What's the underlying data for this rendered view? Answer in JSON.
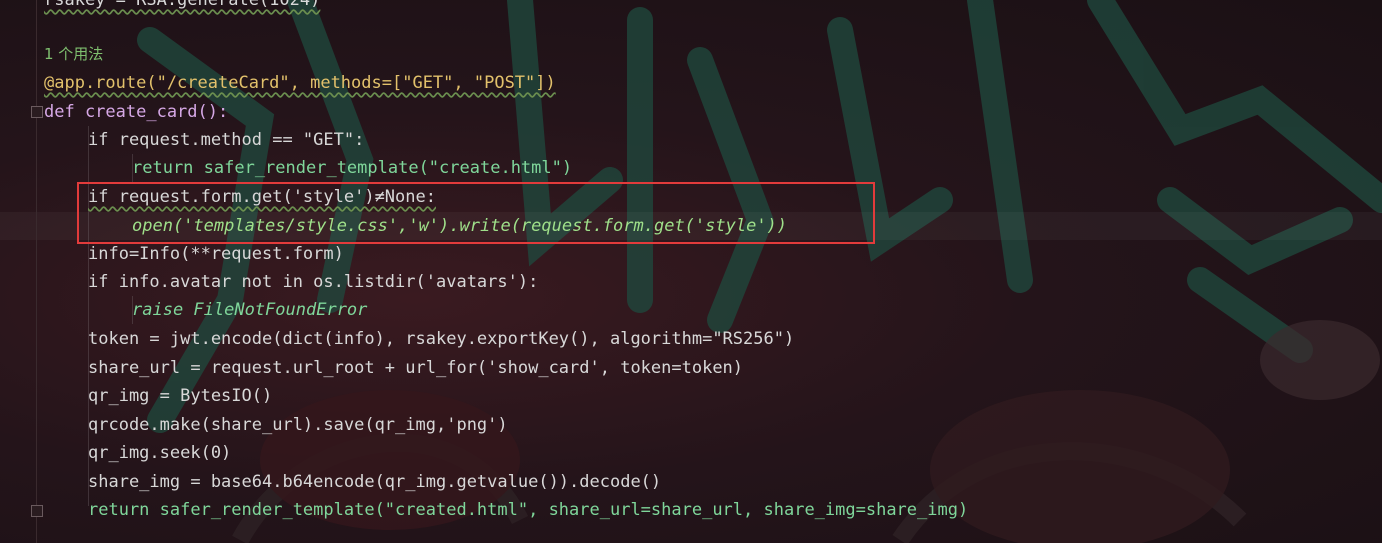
{
  "editor": {
    "hint": "1 个用法",
    "lines": [
      "rsakey = RSA.generate(1024)",
      "@app.route(\"/createCard\", methods=[\"GET\", \"POST\"])",
      "def create_card():",
      "if request.method == \"GET\":",
      "return safer_render_template(\"create.html\")",
      "if request.form.get('style')≠None:",
      "open('templates/style.css','w').write(request.form.get('style'))",
      "info=Info(**request.form)",
      "if info.avatar not in os.listdir('avatars'):",
      "raise FileNotFoundError",
      "token = jwt.encode(dict(info), rsakey.exportKey(), algorithm=\"RS256\")",
      "share_url = request.url_root + url_for('show_card', token=token)",
      "qr_img = BytesIO()",
      "qrcode.make(share_url).save(qr_img,'png')",
      "qr_img.seek(0)",
      "share_img = base64.b64encode(qr_img.getvalue()).decode()",
      "return safer_render_template(\"created.html\", share_url=share_url, share_img=share_img)"
    ]
  },
  "colors": {
    "background": "#1e1418",
    "highlight_box": "#e23b3b",
    "keyword": "#d6a8e6",
    "function_name": "#f6c878",
    "string": "#9fe08a"
  }
}
